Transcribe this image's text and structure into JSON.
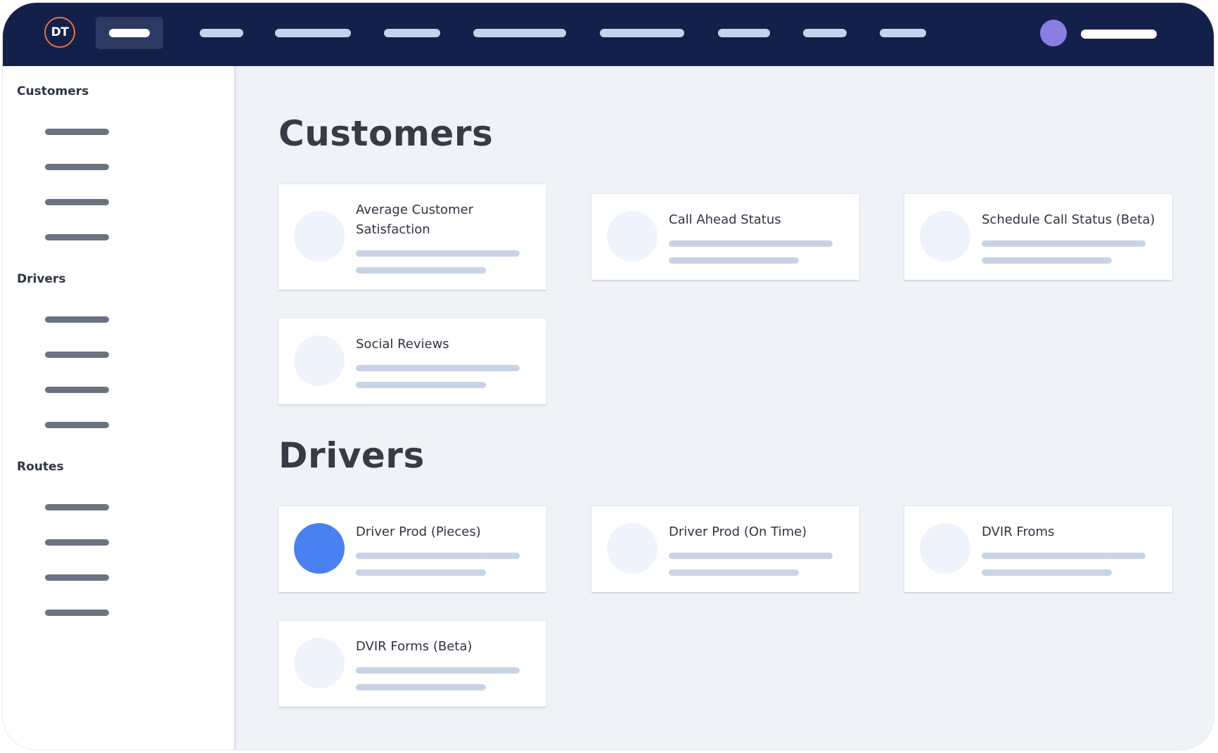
{
  "app": {
    "logo_text": "DT",
    "accent_color": "#e8734a",
    "topbar_color": "#13204a",
    "avatar_color": "#8b7ee3"
  },
  "topnav": {
    "items": [
      {
        "state": "active"
      },
      {
        "state": "default"
      },
      {
        "state": "default"
      },
      {
        "state": "default"
      },
      {
        "state": "default"
      },
      {
        "state": "default"
      },
      {
        "state": "default"
      },
      {
        "state": "default"
      },
      {
        "state": "default"
      }
    ]
  },
  "sidebar": {
    "sections": [
      {
        "heading": "Customers"
      },
      {
        "heading": "Drivers"
      },
      {
        "heading": "Routes"
      }
    ]
  },
  "main": {
    "sections": [
      {
        "title": "Customers",
        "cards": [
          {
            "title": "Average Customer Satisfaction",
            "icon": "metric-icon-placeholder",
            "selected": false
          },
          {
            "title": "Call Ahead Status",
            "icon": "metric-icon-placeholder",
            "selected": false
          },
          {
            "title": "Schedule Call Status (Beta)",
            "icon": "metric-icon-placeholder",
            "selected": false
          },
          {
            "title": "Social Reviews",
            "icon": "metric-icon-placeholder",
            "selected": false
          }
        ]
      },
      {
        "title": "Drivers",
        "cards": [
          {
            "title": "Driver Prod (Pieces)",
            "icon": "metric-icon-active",
            "selected": true,
            "icon_color": "#4a80f0"
          },
          {
            "title": "Driver Prod (On Time)",
            "icon": "metric-icon-placeholder",
            "selected": false
          },
          {
            "title": "DVIR Froms",
            "icon": "metric-icon-placeholder",
            "selected": false
          },
          {
            "title": "DVIR Forms (Beta)",
            "icon": "metric-icon-placeholder",
            "selected": false
          }
        ]
      }
    ]
  }
}
